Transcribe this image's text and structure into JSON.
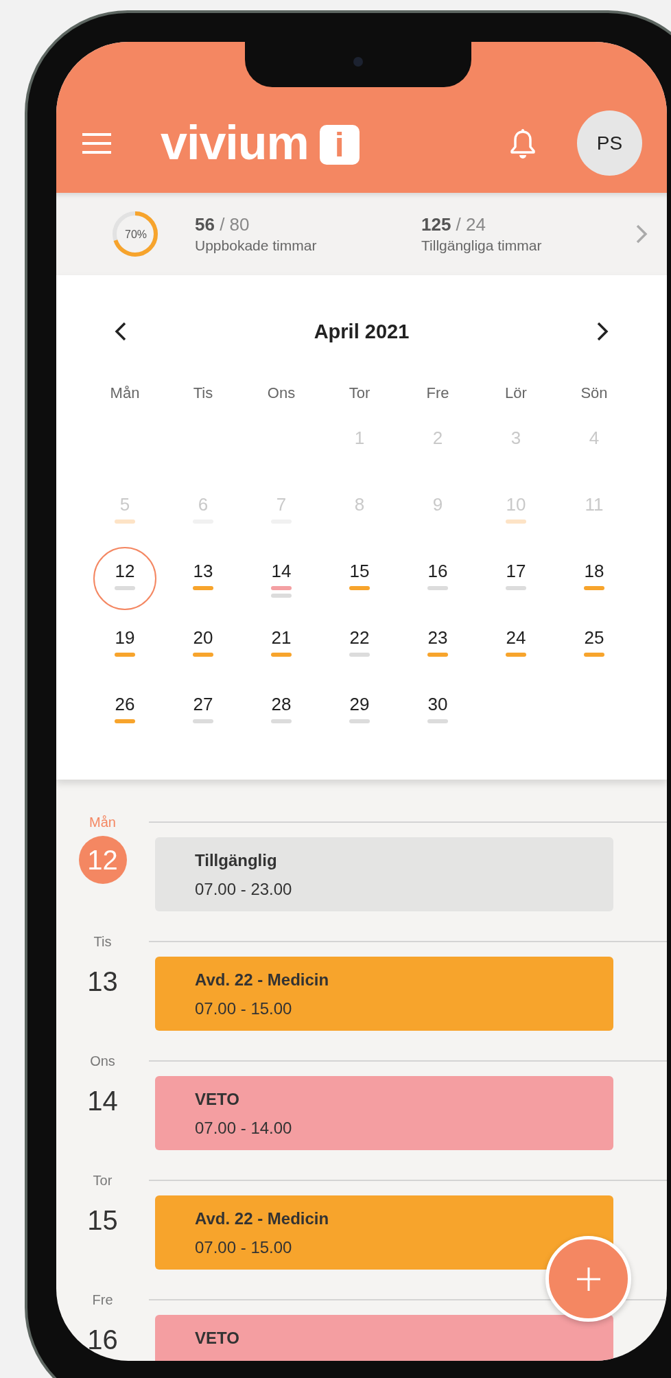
{
  "header": {
    "logo_text": "vivium",
    "logo_mark": "i",
    "avatar_initials": "PS"
  },
  "stats": {
    "level": 0.7,
    "percent": "70%",
    "items": [
      {
        "value": "**56** / 80",
        "label": "Uppbokade timmar"
      },
      {
        "value": "**125** / 24",
        "label": "Tillgängliga timmar"
      }
    ]
  },
  "calendar": {
    "month": "April 2021",
    "weekdays": [
      "Mån",
      "Tis",
      "Ons",
      "Tor",
      "Fre",
      "Lör",
      "Sön"
    ],
    "weeks": [
      [
        {
          "kind": "blank"
        },
        {
          "kind": "blank"
        },
        {
          "kind": "blank"
        },
        {
          "kind": "day",
          "day": "1",
          "muted": true,
          "selected": false
        },
        {
          "kind": "day",
          "day": "2",
          "muted": true,
          "selected": false
        },
        {
          "kind": "day",
          "day": "3",
          "muted": true,
          "selected": false
        },
        {
          "kind": "day",
          "day": "4",
          "muted": true,
          "selected": false
        }
      ],
      [
        {
          "kind": "day",
          "day": "5",
          "muted": true,
          "selected": false,
          "marks": [
            {
              "color": "#fde3c6"
            }
          ]
        },
        {
          "kind": "day",
          "day": "6",
          "muted": true,
          "selected": false,
          "marks": [
            {
              "color": "#f1f1f1"
            }
          ]
        },
        {
          "kind": "day",
          "day": "7",
          "muted": true,
          "selected": false,
          "marks": [
            {
              "color": "#f1f1f1"
            }
          ]
        },
        {
          "kind": "day",
          "day": "8",
          "muted": true,
          "selected": false
        },
        {
          "kind": "day",
          "day": "9",
          "muted": true,
          "selected": false
        },
        {
          "kind": "day",
          "day": "10",
          "muted": true,
          "selected": false,
          "marks": [
            {
              "color": "#fde3c6"
            }
          ]
        },
        {
          "kind": "day",
          "day": "11",
          "muted": true,
          "selected": false
        }
      ],
      [
        {
          "kind": "day",
          "day": "12",
          "muted": false,
          "selected": true,
          "marks": [
            {
              "color": "#dcdcdc"
            }
          ]
        },
        {
          "kind": "day",
          "day": "13",
          "muted": false,
          "selected": false,
          "marks": [
            {
              "color": "#f7a42c"
            }
          ]
        },
        {
          "kind": "day",
          "day": "14",
          "muted": false,
          "selected": false,
          "marks": [
            {
              "color": "#f4a0a3"
            },
            {
              "color": "#dcdcdc"
            }
          ]
        },
        {
          "kind": "day",
          "day": "15",
          "muted": false,
          "selected": false,
          "marks": [
            {
              "color": "#f7a42c"
            }
          ]
        },
        {
          "kind": "day",
          "day": "16",
          "muted": false,
          "selected": false,
          "marks": [
            {
              "color": "#dcdcdc"
            }
          ]
        },
        {
          "kind": "day",
          "day": "17",
          "muted": false,
          "selected": false,
          "marks": [
            {
              "color": "#dcdcdc"
            }
          ]
        },
        {
          "kind": "day",
          "day": "18",
          "muted": false,
          "selected": false,
          "marks": [
            {
              "color": "#f7a42c"
            }
          ]
        }
      ],
      [
        {
          "kind": "day",
          "day": "19",
          "muted": false,
          "selected": false,
          "marks": [
            {
              "color": "#f7a42c"
            }
          ]
        },
        {
          "kind": "day",
          "day": "20",
          "muted": false,
          "selected": false,
          "marks": [
            {
              "color": "#f7a42c"
            }
          ]
        },
        {
          "kind": "day",
          "day": "21",
          "muted": false,
          "selected": false,
          "marks": [
            {
              "color": "#f7a42c"
            }
          ]
        },
        {
          "kind": "day",
          "day": "22",
          "muted": false,
          "selected": false,
          "marks": [
            {
              "color": "#dcdcdc"
            }
          ]
        },
        {
          "kind": "day",
          "day": "23",
          "muted": false,
          "selected": false,
          "marks": [
            {
              "color": "#f7a42c"
            }
          ]
        },
        {
          "kind": "day",
          "day": "24",
          "muted": false,
          "selected": false,
          "marks": [
            {
              "color": "#f7a42c"
            }
          ]
        },
        {
          "kind": "day",
          "day": "25",
          "muted": false,
          "selected": false,
          "marks": [
            {
              "color": "#f7a42c"
            }
          ]
        }
      ],
      [
        {
          "kind": "day",
          "day": "26",
          "muted": false,
          "selected": false,
          "marks": [
            {
              "color": "#f7a42c"
            }
          ]
        },
        {
          "kind": "day",
          "day": "27",
          "muted": false,
          "selected": false,
          "marks": [
            {
              "color": "#dcdcdc"
            }
          ]
        },
        {
          "kind": "day",
          "day": "28",
          "muted": false,
          "selected": false,
          "marks": [
            {
              "color": "#dcdcdc"
            }
          ]
        },
        {
          "kind": "day",
          "day": "29",
          "muted": false,
          "selected": false,
          "marks": [
            {
              "color": "#dcdcdc"
            }
          ]
        },
        {
          "kind": "day",
          "day": "30",
          "muted": false,
          "selected": false,
          "marks": [
            {
              "color": "#dcdcdc"
            }
          ]
        },
        {
          "kind": "blank"
        },
        {
          "kind": "blank"
        }
      ]
    ]
  },
  "agenda": [
    {
      "weekday": "Mån",
      "date": "12",
      "today": true,
      "events": [
        {
          "title": "Tillgänglig",
          "time": "07.00 - 23.00",
          "color": "#e4e4e3"
        }
      ]
    },
    {
      "weekday": "Tis",
      "date": "13",
      "today": false,
      "events": [
        {
          "title": "Avd. 22 - Medicin",
          "time": "07.00 - 15.00",
          "color": "#f7a42c"
        }
      ]
    },
    {
      "weekday": "Ons",
      "date": "14",
      "today": false,
      "events": [
        {
          "title": "VETO",
          "time": "07.00 - 14.00",
          "color": "#f49ea1"
        }
      ]
    },
    {
      "weekday": "Tor",
      "date": "15",
      "today": false,
      "events": [
        {
          "title": "Avd. 22 - Medicin",
          "time": "07.00 - 15.00",
          "color": "#f7a42c"
        }
      ]
    },
    {
      "weekday": "Fre",
      "date": "16",
      "today": false,
      "events": [
        {
          "title": "VETO",
          "color": "#f49ea1"
        }
      ]
    }
  ]
}
